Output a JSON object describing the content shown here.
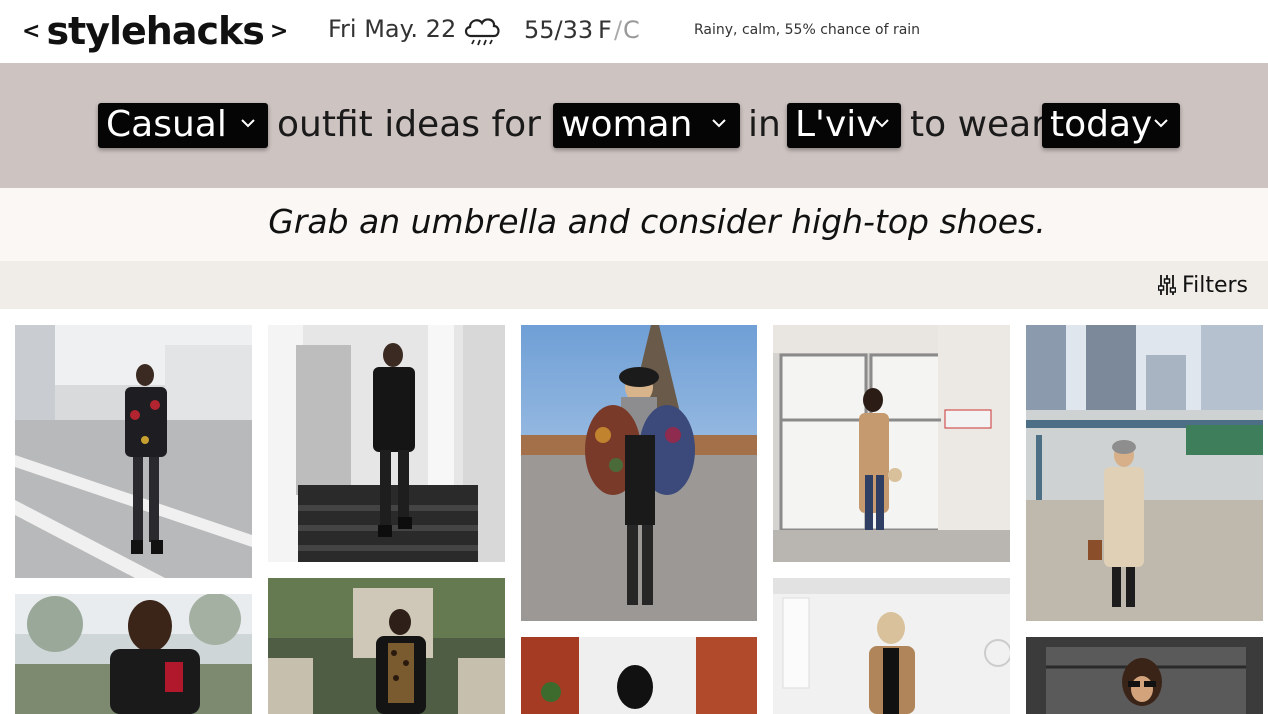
{
  "header": {
    "logo_left": "<",
    "logo_text": "stylehacks",
    "logo_right": ">",
    "date": "Fri May. 22",
    "weather_icon": "rain-cloud-icon",
    "temps": "55/33",
    "unit_f": "F",
    "unit_sep": "/",
    "unit_c": "C",
    "weather_desc": "Rainy, calm, 55% chance of rain"
  },
  "selector": {
    "style": "Casual",
    "text1": "outfit ideas for a",
    "gender": "woman",
    "text2": "in",
    "city": "L'viv",
    "text3": "to wear",
    "when": "today"
  },
  "tip": "Grab an umbrella and consider high-top shoes.",
  "filters": {
    "label": "Filters",
    "icon": "sliders-icon"
  },
  "colors": {
    "selector_bg": "#cdc3c1",
    "tip_bg": "#faf7f4",
    "filter_bg": "#f0ece7",
    "dropdown_bg": "#050505"
  },
  "outfits": [
    {
      "scene": "street crosswalk",
      "outfit": "black leather jacket, black jeans"
    },
    {
      "scene": "white building steps",
      "outfit": "black sweater, black jeans, ankle boots"
    },
    {
      "scene": "eiffel tower",
      "outfit": "multicolor fur jacket, black pinafore dress, beret"
    },
    {
      "scene": "glass doors",
      "outfit": "camel coat, jeans, white sneakers"
    },
    {
      "scene": "urban courtyard",
      "outfit": "beige coat, black jeans, beanie"
    },
    {
      "scene": "park",
      "outfit": "black sweater, coffee cup"
    },
    {
      "scene": "ivy garden",
      "outfit": "leopard top, black jacket"
    },
    {
      "scene": "red door",
      "outfit": "black beanie"
    },
    {
      "scene": "white interior",
      "outfit": "camel coat"
    },
    {
      "scene": "balcony",
      "outfit": "sunglasses"
    }
  ]
}
